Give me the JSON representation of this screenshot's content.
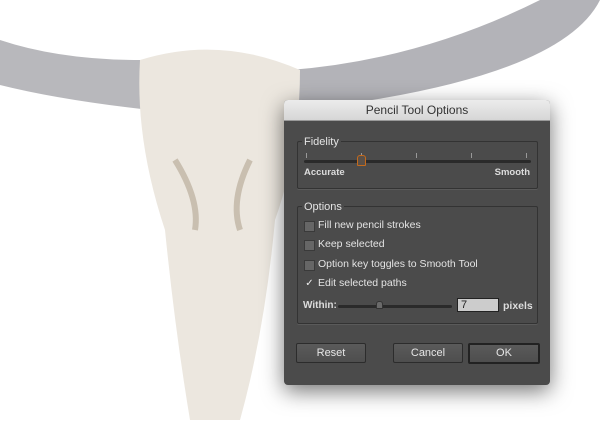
{
  "dialog": {
    "title": "Pencil Tool Options",
    "fidelity": {
      "label": "Fidelity",
      "min_label": "Accurate",
      "max_label": "Smooth",
      "value_fraction": 0.25
    },
    "options": {
      "label": "Options",
      "checkboxes": [
        {
          "label": "Fill new pencil strokes",
          "checked": false
        },
        {
          "label": "Keep selected",
          "checked": false
        },
        {
          "label": "Option key toggles to Smooth Tool",
          "checked": false
        },
        {
          "label": "Edit selected paths",
          "checked": true
        }
      ],
      "within": {
        "label": "Within:",
        "value": "7",
        "unit": "pixels",
        "slider_fraction": 0.36
      }
    },
    "buttons": {
      "reset": "Reset",
      "cancel": "Cancel",
      "ok": "OK"
    },
    "accent": "#c46a1c"
  }
}
